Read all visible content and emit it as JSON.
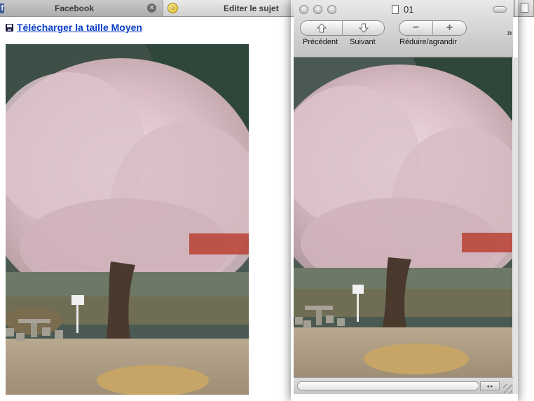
{
  "browser": {
    "tabs": [
      {
        "label": "Facebook",
        "favicon": "facebook-icon",
        "close": "×"
      },
      {
        "label": "Editer le sujet",
        "favicon": "smiley-icon"
      }
    ]
  },
  "page": {
    "download_link": "Télécharger la taille Moyen",
    "download_icon": "floppy-disk-icon"
  },
  "preview": {
    "window_title": "01",
    "toolbar": {
      "prev_label": "Précédent",
      "next_label": "Suivant",
      "zoom_label": "Réduire/agrandir",
      "zoom_out_glyph": "−",
      "zoom_in_glyph": "+",
      "overflow_glyph": "»"
    },
    "scroll_arrows": "◂ ▸"
  },
  "colors": {
    "link": "#0b3fc7",
    "facebook": "#3b5998",
    "window_chrome": "#cdcdcd"
  }
}
